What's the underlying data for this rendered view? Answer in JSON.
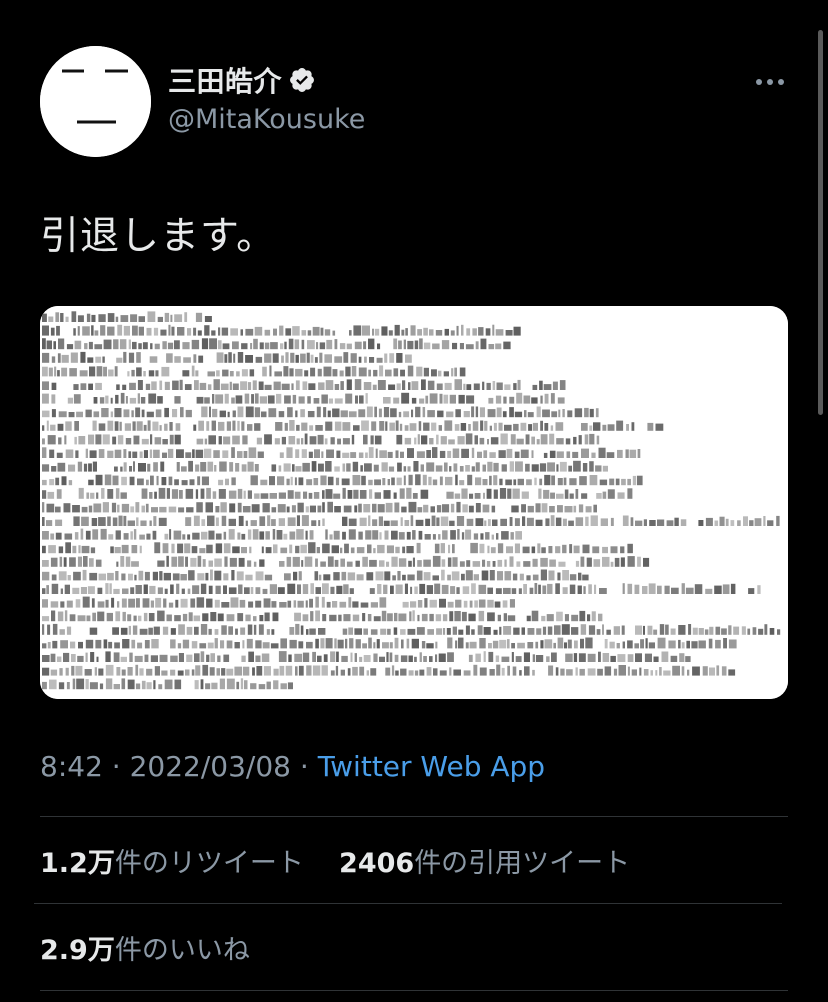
{
  "author": {
    "display_name": "三田皓介",
    "handle": "@MitaKousuke",
    "verified_icon": "verified-badge-icon"
  },
  "tweet": {
    "text": "引退します。",
    "media_type": "text-screenshot-image"
  },
  "meta": {
    "time": "8:42",
    "separator_1": " · ",
    "date": "2022/03/08",
    "separator_2": " · ",
    "source": "Twitter Web App"
  },
  "stats": {
    "retweets": {
      "count": "1.2",
      "unit": "万",
      "label": "件のリツイート"
    },
    "quotes": {
      "count": "2406",
      "label": "件の引用ツイート"
    },
    "likes": {
      "count": "2.9",
      "unit": "万",
      "label": "件のいいね"
    }
  },
  "colors": {
    "background": "#000000",
    "primary_text": "#e7e9ea",
    "secondary_text": "#8b98a5",
    "link": "#4a9ee9",
    "divider": "#2f3336"
  }
}
